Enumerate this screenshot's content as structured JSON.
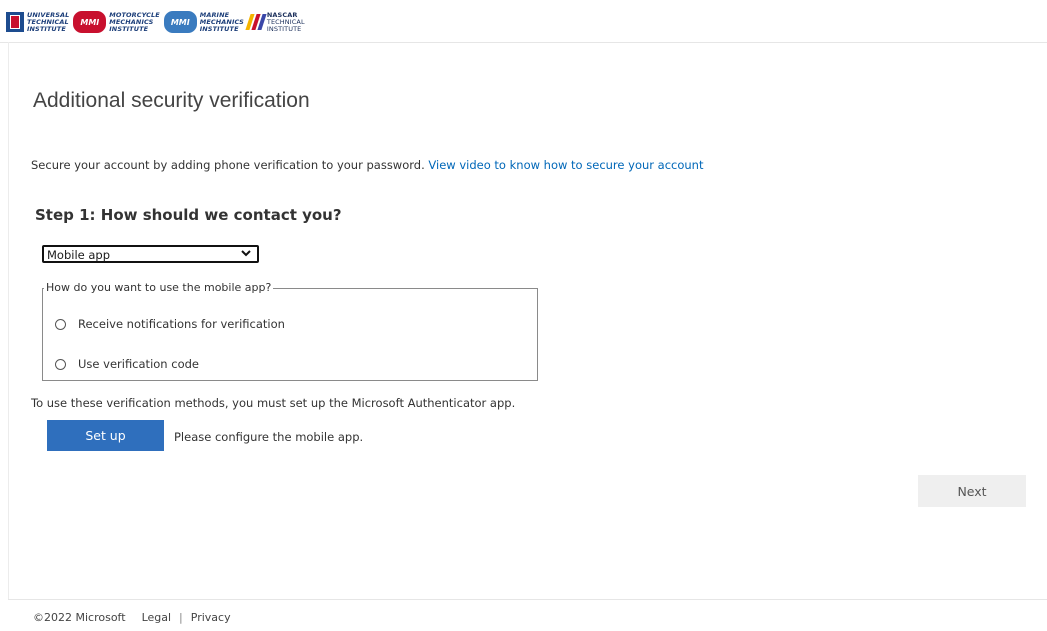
{
  "header": {
    "logos": [
      {
        "name": "uti-logo",
        "lines": [
          "UNIVERSAL",
          "TECHNICAL",
          "INSTITUTE"
        ]
      },
      {
        "name": "mmi-logo",
        "badge": "MMI",
        "lines": [
          "MOTORCYCLE",
          "MECHANICS",
          "INSTITUTE"
        ]
      },
      {
        "name": "marine-logo",
        "badge": "MMI",
        "lines": [
          "MARINE",
          "MECHANICS",
          "INSTITUTE"
        ]
      },
      {
        "name": "nascar-logo",
        "lines": [
          "NASCAR",
          "TECHNICAL",
          "INSTITUTE"
        ]
      }
    ]
  },
  "page": {
    "title": "Additional security verification",
    "intro": "Secure your account by adding phone verification to your password.",
    "intro_link": "View video to know how to secure your account"
  },
  "step1": {
    "title": "Step 1: How should we contact you?",
    "method_selected": "Mobile app",
    "mode_legend": "How do you want to use the mobile app?",
    "options": [
      {
        "label": "Receive notifications for verification"
      },
      {
        "label": "Use verification code"
      }
    ],
    "authenticator_note": "To use these verification methods, you must set up the Microsoft Authenticator app.",
    "setup_button": "Set up",
    "setup_hint": "Please configure the mobile app."
  },
  "actions": {
    "next": "Next"
  },
  "footer": {
    "copyright": "©2022 Microsoft",
    "legal": "Legal",
    "separator": "|",
    "privacy": "Privacy"
  },
  "colors": {
    "accent": "#2f6fbd",
    "link": "#0067b8",
    "uti_blue": "#1d4c8f",
    "uti_red": "#c8102e"
  }
}
